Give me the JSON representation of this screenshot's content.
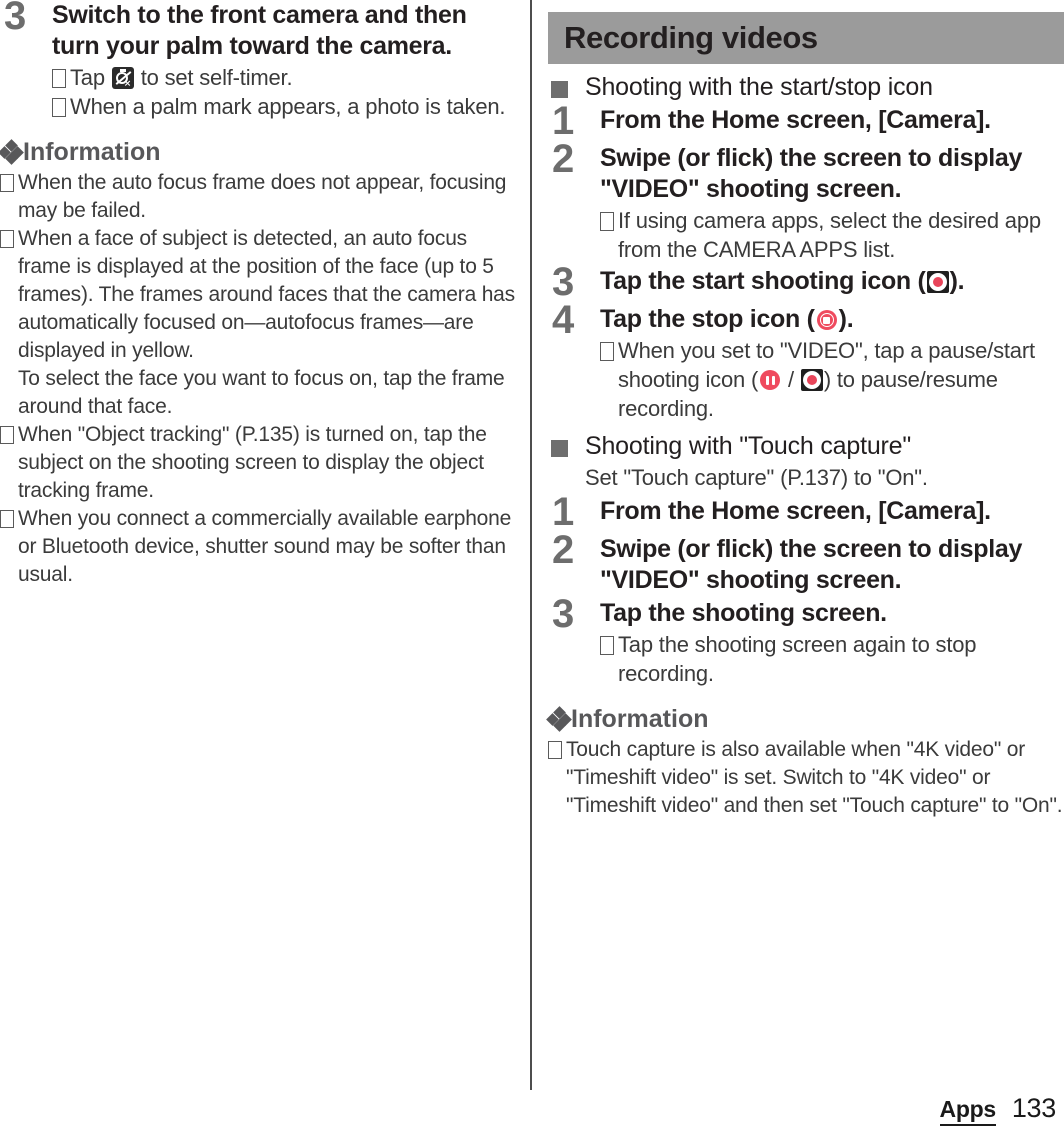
{
  "page": {
    "number": "133",
    "chapter_label": "Apps",
    "bullet_glyph": "box"
  },
  "left_column": {
    "step": {
      "number": "3",
      "title": "Switch to the front camera and then turn your palm toward the camera.",
      "bullets": [
        {
          "pre": "Tap ",
          "icon": "self-timer-off-icon",
          "post": " to set self-timer."
        },
        {
          "pre": "When a palm mark appears, a photo is taken.",
          "icon": "",
          "post": ""
        }
      ]
    },
    "information": {
      "heading": "Information",
      "items": [
        {
          "text": "When the auto focus frame does not appear, focusing may be failed."
        },
        {
          "text": "When a face of subject is detected, an auto focus frame is displayed at the position of the face (up to 5 frames). The frames around faces that the camera has automatically focused on—autofocus frames—are displayed in yellow."
        },
        {
          "continuation": "To select the face you want to focus on, tap the frame around that face."
        },
        {
          "text": "When \"Object tracking\" (P.135) is turned on, tap the subject on the shooting screen to display the object tracking frame."
        },
        {
          "text": "When you connect a commercially available earphone or Bluetooth device, shutter sound may be softer than usual."
        }
      ]
    }
  },
  "right_column": {
    "chapter_banner": "Recording videos",
    "section_1": {
      "title": "Shooting with the start/stop icon",
      "steps": [
        {
          "number": "1",
          "title": "From the Home screen, [Camera].",
          "bullets": []
        },
        {
          "number": "2",
          "title": "Swipe (or flick) the screen to display \"VIDEO\" shooting screen.",
          "bullets": [
            {
              "text": "If using camera apps, select the desired app from the CAMERA APPS list."
            }
          ]
        },
        {
          "number": "3",
          "title_pre": "Tap the start shooting icon (",
          "title_icon": "start-shooting-icon",
          "title_post": ").",
          "bullets": []
        },
        {
          "number": "4",
          "title_pre": "Tap the stop icon (",
          "title_icon": "stop-recording-icon",
          "title_post": ").",
          "bullets": [
            {
              "seg1": "When you set to \"VIDEO\", tap a pause/start shooting icon (",
              "icon1": "pause-recording-icon",
              "seg2": " / ",
              "icon2": "start-shooting-icon",
              "seg3": ") to pause/resume recording."
            }
          ]
        }
      ]
    },
    "section_2": {
      "title": "Shooting with \"Touch capture\"",
      "subtitle": "Set \"Touch capture\" (P.137) to \"On\".",
      "steps": [
        {
          "number": "1",
          "title": "From the Home screen, [Camera].",
          "bullets": []
        },
        {
          "number": "2",
          "title": "Swipe (or flick) the screen to display \"VIDEO\" shooting screen.",
          "bullets": []
        },
        {
          "number": "3",
          "title": "Tap the shooting screen.",
          "bullets": [
            {
              "text": "Tap the shooting screen again to stop recording."
            }
          ]
        }
      ]
    },
    "information": {
      "heading": "Information",
      "items": [
        {
          "text": "Touch capture is also available when \"4K video\" or \"Timeshift video\" is set. Switch to \"4K video\" or \"Timeshift video\" and then set \"Touch capture\" to \"On\"."
        }
      ]
    }
  }
}
